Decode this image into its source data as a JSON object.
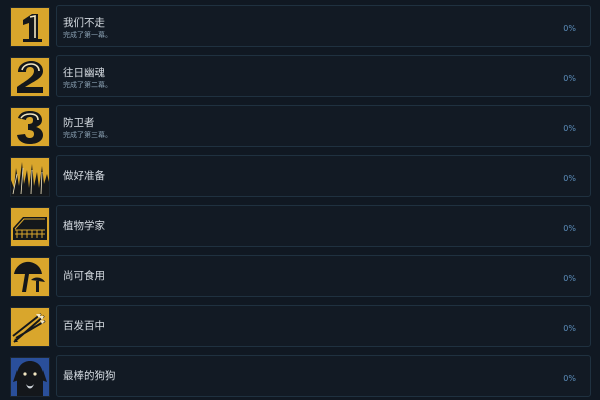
{
  "achievements": [
    {
      "icon": "number-one-icon",
      "title": "我们不走",
      "description": "完成了第一幕。",
      "percent": "0%"
    },
    {
      "icon": "number-two-icon",
      "title": "往日幽魂",
      "description": "完成了第二幕。",
      "percent": "0%"
    },
    {
      "icon": "number-three-icon",
      "title": "防卫者",
      "description": "完成了第三幕。",
      "percent": "0%"
    },
    {
      "icon": "spiky-grass-icon",
      "title": "做好准备",
      "description": "",
      "percent": "0%"
    },
    {
      "icon": "greenhouse-icon",
      "title": "植物学家",
      "description": "",
      "percent": "0%"
    },
    {
      "icon": "mushroom-icon",
      "title": "尚可食用",
      "description": "",
      "percent": "0%"
    },
    {
      "icon": "arrows-icon",
      "title": "百发百中",
      "description": "",
      "percent": "0%"
    },
    {
      "icon": "dog-face-icon",
      "title": "最棒的狗狗",
      "description": "",
      "percent": "0%"
    }
  ],
  "colors": {
    "icon_gold": "#d9a62c",
    "icon_dark": "#14171b",
    "panel_bg": "#121a24",
    "panel_border": "#1f3140",
    "percent_text": "#5c8fbd"
  }
}
